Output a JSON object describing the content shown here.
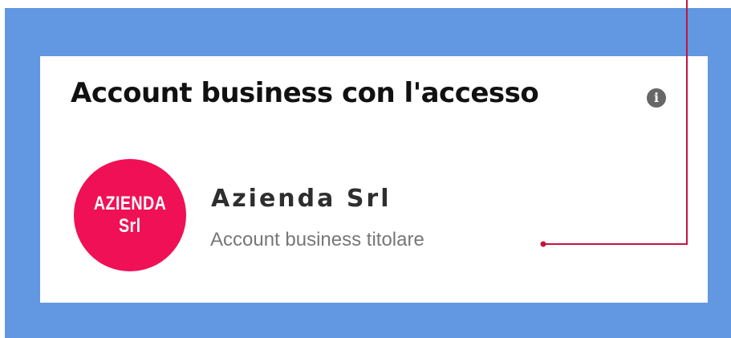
{
  "section": {
    "title": "Account business con l'accesso",
    "info_icon": "info-icon",
    "info_glyph": "i"
  },
  "business": {
    "avatar_line1": "AZIENDA",
    "avatar_line2": "Srl",
    "avatar_color": "#f01055",
    "name": "Azienda Srl",
    "role": "Account business titolare"
  },
  "colors": {
    "frame_background": "#6298e2",
    "card_background": "#ffffff",
    "callout_line": "#c4153f"
  }
}
